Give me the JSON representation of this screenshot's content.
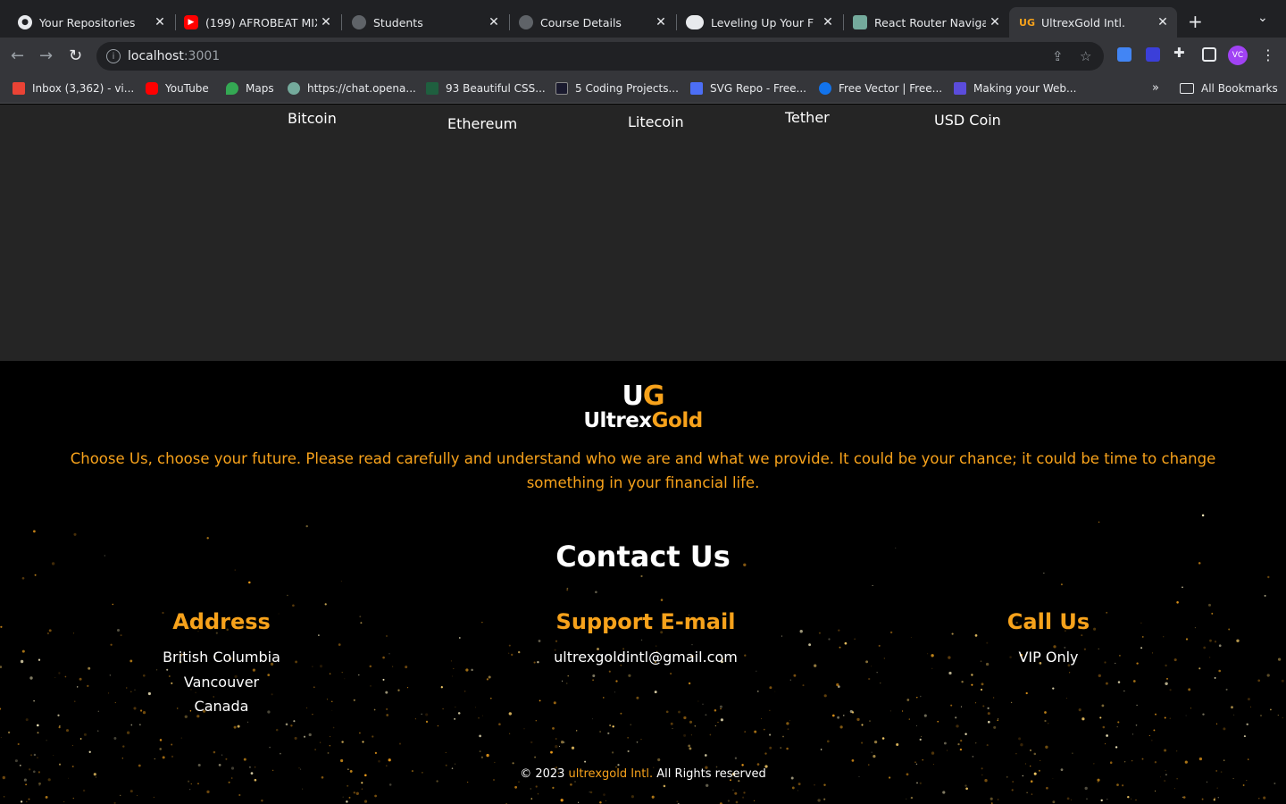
{
  "browser": {
    "tabs": [
      {
        "title": "Your Repositories",
        "active": false
      },
      {
        "title": "(199) AFROBEAT MIX",
        "active": false
      },
      {
        "title": "Students",
        "active": false
      },
      {
        "title": "Course Details",
        "active": false
      },
      {
        "title": "Leveling Up Your F",
        "active": false
      },
      {
        "title": "React Router Navigati",
        "active": false
      },
      {
        "title": "UltrexGold Intl.",
        "active": true
      }
    ],
    "address": {
      "host": "localhost",
      "port": ":3001"
    },
    "profile_initials": "VC",
    "bookmarks": [
      "Inbox (3,362) - vi...",
      "YouTube",
      "Maps",
      "https://chat.opena...",
      "93 Beautiful CSS...",
      "5 Coding Projects...",
      "SVG Repo - Free...",
      "Free Vector | Free...",
      "Making your Web..."
    ],
    "all_bookmarks_label": "All Bookmarks",
    "more_bookmarks_glyph": "»"
  },
  "coins": [
    "Bitcoin",
    "Ethereum",
    "Litecoin",
    "Tether",
    "USD Coin"
  ],
  "footer": {
    "logo_mark": {
      "part1": "U",
      "part2": "G"
    },
    "logo_word": {
      "part1": "Ultrex",
      "part2": "Gold"
    },
    "tagline": "Choose Us, choose your future. Please read carefully and understand who we are and what we provide. It could be your chance; it could be time to change something in your financial life.",
    "contact_title": "Contact Us",
    "address": {
      "heading": "Address",
      "lines": [
        "British Columbia",
        "Vancouver",
        "Canada"
      ]
    },
    "email": {
      "heading": "Support E-mail",
      "value": "ultrexgoldintl@gmail.com"
    },
    "call": {
      "heading": "Call Us",
      "value": "VIP Only"
    },
    "copyright": {
      "prefix": "© 2023",
      "brand": "ultrexgold Intl.",
      "suffix": "All Rights reserved"
    }
  },
  "colors": {
    "accent": "#f7a21b",
    "strip": "#252525",
    "footer": "#000000"
  }
}
